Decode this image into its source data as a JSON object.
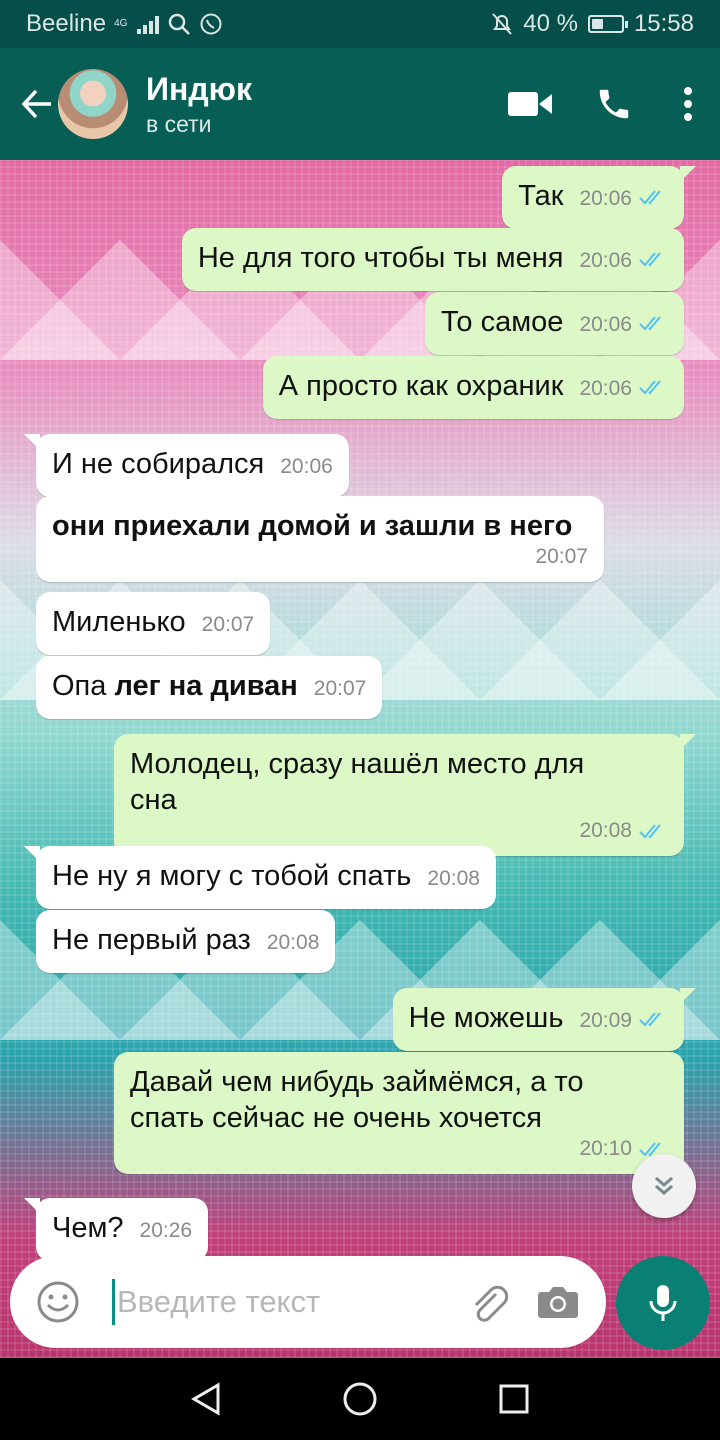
{
  "status_bar": {
    "carrier": "Beeline",
    "network": "4G",
    "battery": "40 %",
    "battery_level": 0.4,
    "time": "15:58"
  },
  "header": {
    "contact_name": "Индюк",
    "contact_status": "в сети"
  },
  "messages": [
    {
      "dir": "out",
      "text": "Так",
      "time": "20:06"
    },
    {
      "dir": "out",
      "text": "Не для того чтобы ты меня",
      "time": "20:06"
    },
    {
      "dir": "out",
      "text": "То самое",
      "time": "20:06"
    },
    {
      "dir": "out",
      "text": "А просто как охраник",
      "time": "20:06"
    },
    {
      "dir": "in",
      "text": "И не собирался",
      "time": "20:06"
    },
    {
      "dir": "in",
      "text": "они приехали домой и зашли в него",
      "time": "20:07"
    },
    {
      "dir": "in",
      "text": "Миленько",
      "time": "20:07"
    },
    {
      "dir": "in",
      "text_plain": "Опа",
      "text_bold": "лег на диван",
      "time": "20:07"
    },
    {
      "dir": "out",
      "text_line1": "Молодец, сразу нашёл место для",
      "text_line2": "сна",
      "time": "20:08"
    },
    {
      "dir": "in",
      "text": "Не ну я могу с тобой спать",
      "time": "20:08"
    },
    {
      "dir": "in",
      "text": "Не первый раз",
      "time": "20:08"
    },
    {
      "dir": "out",
      "text": "Не можешь",
      "time": "20:09"
    },
    {
      "dir": "out",
      "text_line1": "Давай чем нибудь займёмся, а то",
      "text_line2": "спать сейчас не очень хочется",
      "time": "20:10"
    },
    {
      "dir": "in",
      "text": "Чем?",
      "time": "20:26"
    }
  ],
  "input": {
    "placeholder": "Введите текст"
  },
  "colors": {
    "header": "#075e54",
    "outgoing_bubble": "#dcf8c6",
    "incoming_bubble": "#ffffff",
    "read_ticks": "#4fc3f7",
    "mic_button": "#0a8075"
  },
  "icons": [
    "back-arrow-icon",
    "video-call-icon",
    "phone-icon",
    "more-vert-icon",
    "emoji-icon",
    "attach-icon",
    "camera-icon",
    "mic-icon",
    "scroll-down-icon",
    "nav-back-icon",
    "nav-home-icon",
    "nav-recents-icon"
  ]
}
